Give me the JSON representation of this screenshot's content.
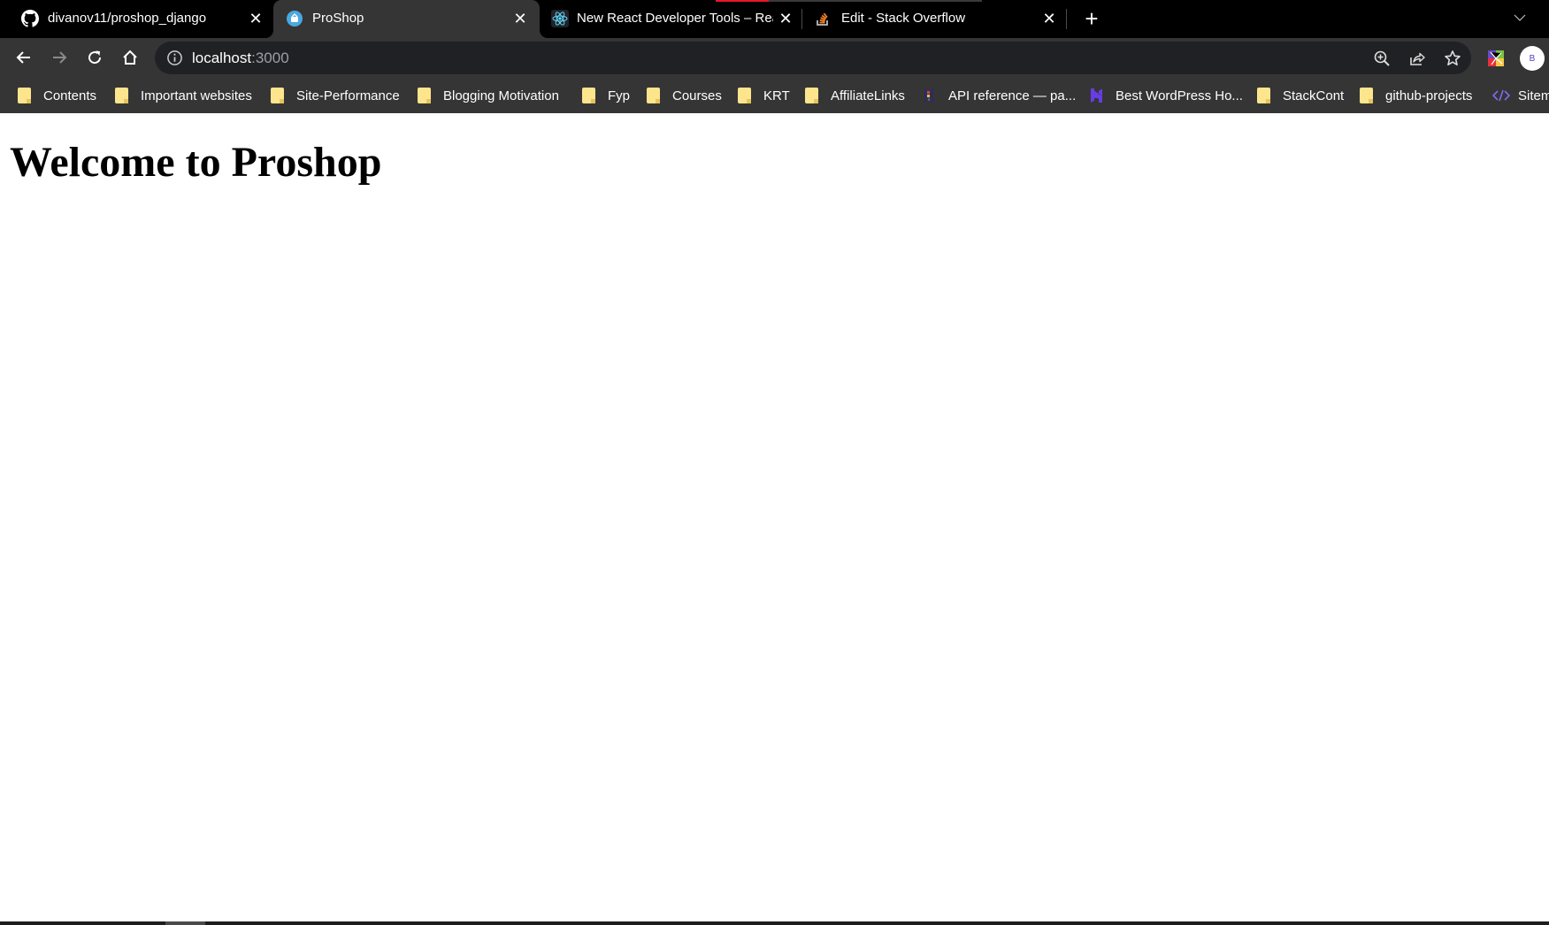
{
  "tabs": [
    {
      "title": "divanov11/proshop_django",
      "icon": "github-icon",
      "active": false
    },
    {
      "title": "ProShop",
      "icon": "proshop-favicon",
      "active": true
    },
    {
      "title": "New React Developer Tools – Rea",
      "icon": "react-icon",
      "active": false
    },
    {
      "title": "Edit - Stack Overflow",
      "icon": "stackoverflow-icon",
      "active": false
    }
  ],
  "toolbar": {
    "url_host": "localhost",
    "url_port": ":3000",
    "avatar_initial": "B"
  },
  "bookmarks": [
    {
      "label": "Contents",
      "icon": "folder-icon"
    },
    {
      "label": "Important websites",
      "icon": "folder-icon"
    },
    {
      "label": "Site-Performance",
      "icon": "folder-icon"
    },
    {
      "label": "Blogging Motivation",
      "icon": "folder-icon"
    },
    {
      "label": "Fyp",
      "icon": "folder-icon"
    },
    {
      "label": "Courses",
      "icon": "folder-icon"
    },
    {
      "label": "KRT",
      "icon": "folder-icon"
    },
    {
      "label": "AffiliateLinks",
      "icon": "folder-icon"
    },
    {
      "label": "API reference — pa...",
      "icon": "api-reference-icon"
    },
    {
      "label": "Best WordPress Ho...",
      "icon": "hostinger-icon"
    },
    {
      "label": "StackCont",
      "icon": "folder-icon"
    },
    {
      "label": "github-projects",
      "icon": "folder-icon"
    },
    {
      "label": "Sitem",
      "icon": "code-icon"
    }
  ],
  "page": {
    "heading": "Welcome to Proshop"
  },
  "colors": {
    "tab_strip": "#000000",
    "toolbar": "#353535",
    "omnibox": "#202124",
    "loading_indicator": "#e8162a",
    "folder": "#fde58e"
  }
}
